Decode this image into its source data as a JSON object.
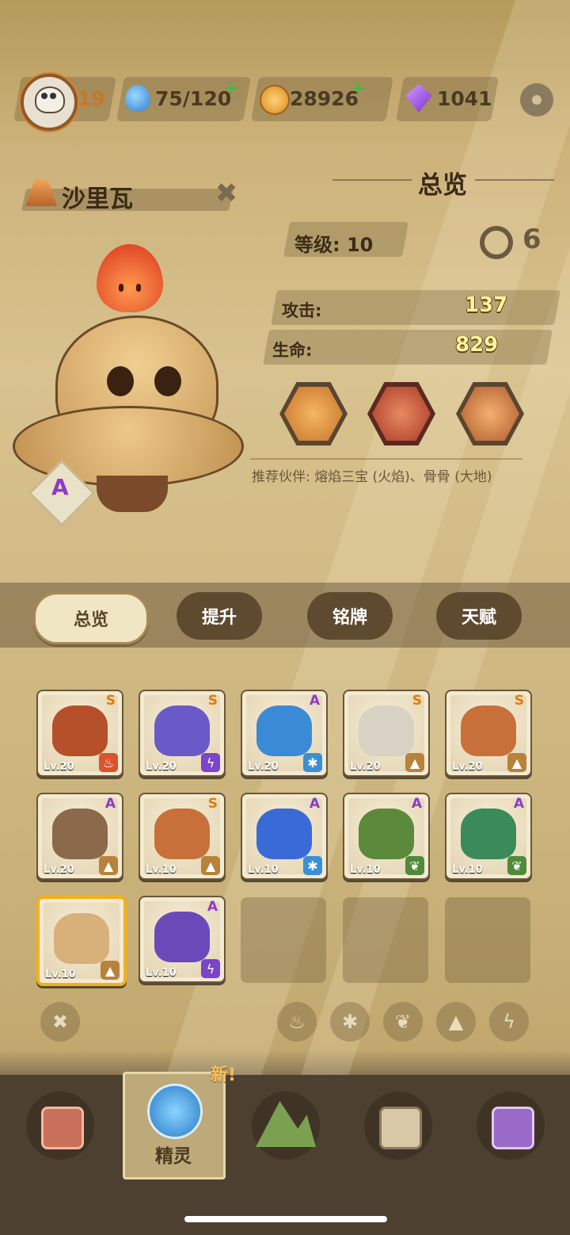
{
  "resources": {
    "player_level": "19",
    "water": "75/120",
    "coins": "28926",
    "gems": "1041"
  },
  "spirit": {
    "name": "沙里瓦",
    "grade": "A"
  },
  "panel": {
    "title": "总览",
    "level_label": "等级: 10",
    "attack_label": "攻击:",
    "attack_value": "137",
    "hp_label": "生命:",
    "hp_value": "829",
    "partner_text": "推荐伙伴: 熔焰三宝 (火焰)、骨骨 (大地)"
  },
  "tabs": [
    "总览",
    "提升",
    "铭牌",
    "天赋"
  ],
  "cards": [
    {
      "lv": "Lv.20",
      "grade": "S",
      "element": "fire"
    },
    {
      "lv": "Lv.20",
      "grade": "S",
      "element": "thunder"
    },
    {
      "lv": "Lv.20",
      "grade": "A",
      "element": "ice"
    },
    {
      "lv": "Lv.20",
      "grade": "S",
      "element": "earth"
    },
    {
      "lv": "Lv.20",
      "grade": "S",
      "element": "earth"
    },
    {
      "lv": "Lv.20",
      "grade": "A",
      "element": "earth"
    },
    {
      "lv": "Lv.10",
      "grade": "S",
      "element": "earth"
    },
    {
      "lv": "Lv.10",
      "grade": "A",
      "element": "ice"
    },
    {
      "lv": "Lv.10",
      "grade": "A",
      "element": "leaf"
    },
    {
      "lv": "Lv.10",
      "grade": "A",
      "element": "leaf"
    },
    {
      "lv": "Lv.10",
      "grade": "",
      "element": "earth"
    },
    {
      "lv": "Lv.10",
      "grade": "A",
      "element": "thunder"
    }
  ],
  "bottom_nav": {
    "spirit_label": "精灵",
    "new_badge": "新!"
  },
  "colors": {
    "grade_S": "#e07a10",
    "grade_A": "#8a3cc8",
    "fire": "#d9532b",
    "thunder": "#7a45c8",
    "ice": "#3a8fd6",
    "earth": "#b8823a",
    "leaf": "#4f8a3a"
  }
}
